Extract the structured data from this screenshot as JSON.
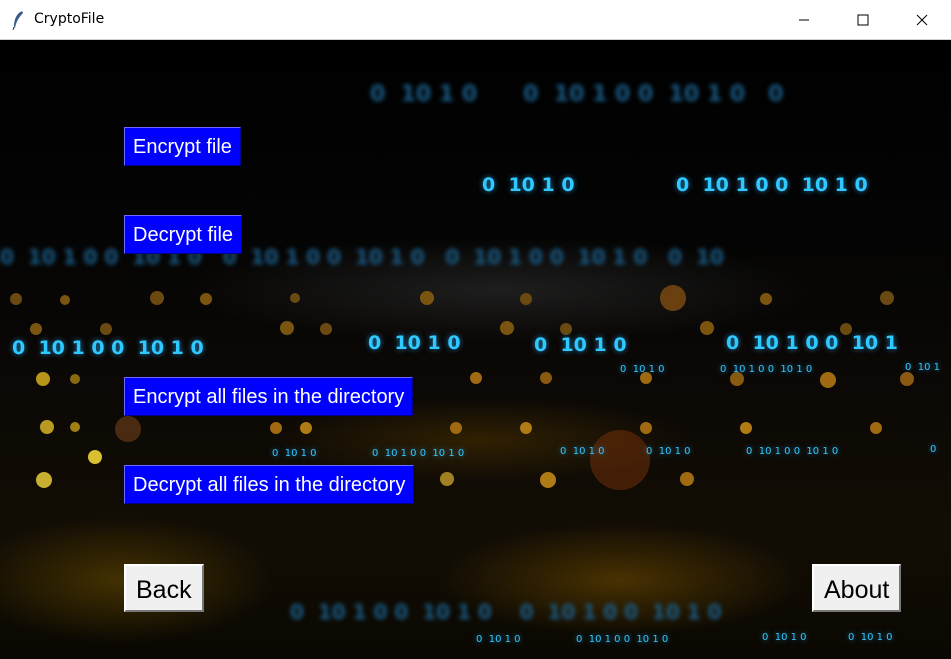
{
  "window": {
    "title": "CryptoFile",
    "controls": [
      "minimize-icon",
      "maximize-icon",
      "close-icon"
    ]
  },
  "buttons": {
    "encrypt_file": "Encrypt file",
    "decrypt_file": "Decrypt file",
    "encrypt_all": "Encrypt all files in the directory",
    "decrypt_all": "Decrypt all files in the directory",
    "back": "Back",
    "about": "About"
  },
  "background": {
    "binary_row_1": [
      "0  10 1 0",
      "0  10 1 0 0  10 1 0"
    ],
    "binary_row_2": [
      "0  10 1 0 0  10 1 0",
      "0  10 1 0",
      "0  10 1 0",
      "0  10 1 0 0  10 1"
    ],
    "colors": {
      "button_blue": "#0000ff",
      "binary_cyan": "#2fc8ff"
    }
  }
}
